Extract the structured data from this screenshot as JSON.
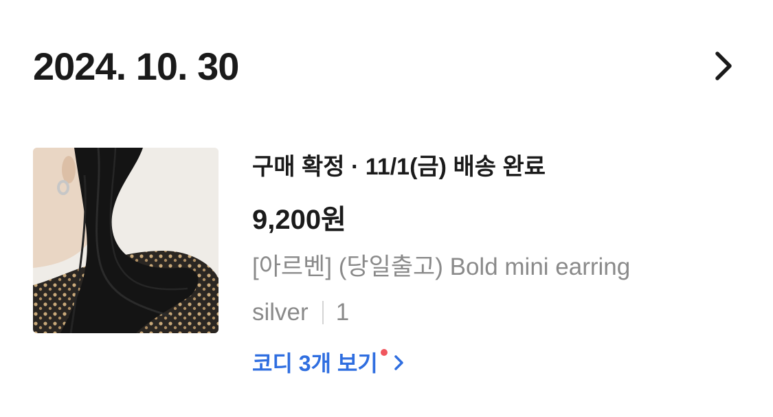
{
  "order": {
    "date": "2024. 10. 30",
    "status_text": "구매 확정 · 11/1(금) 배송 완료",
    "price": "9,200원",
    "product_name": "[아르벤] (당일출고) Bold mini earring",
    "option": "silver",
    "quantity": "1"
  },
  "codi_link": {
    "label": "코디 3개 보기"
  },
  "icons": {
    "header": "chevron-right-icon",
    "link": "chevron-right-icon",
    "badge": "notification-dot-icon"
  },
  "colors": {
    "link_blue": "#2f6ee0",
    "badge_red": "#f0565e",
    "muted_text": "#8a8a8a",
    "primary_text": "#1a1a1a"
  }
}
